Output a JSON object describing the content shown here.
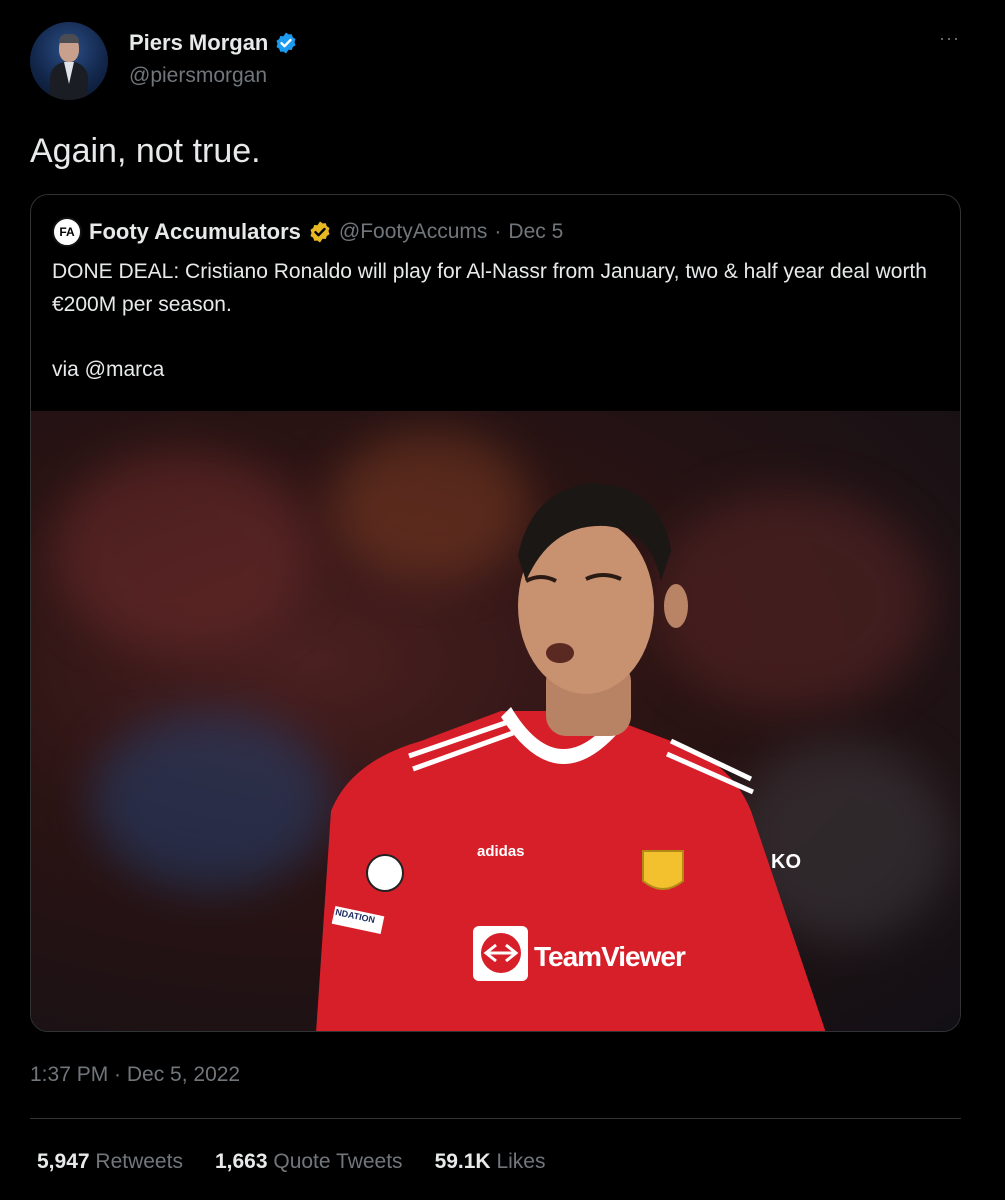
{
  "author": {
    "name": "Piers Morgan",
    "handle": "@piersmorgan",
    "verified_badge_color": "#1d9bf0"
  },
  "more_menu": "···",
  "tweet": {
    "text": "Again, not true.",
    "timestamp": "1:37 PM · Dec 5, 2022"
  },
  "quoted_tweet": {
    "logo_text": "FA",
    "name": "Footy Accumulators",
    "verified_badge_color": "#e8b823",
    "handle": "@FootyAccums",
    "separator": "·",
    "date": "Dec 5",
    "body_line1": "DONE DEAL: Cristiano Ronaldo will play for Al-Nassr from January, two & half year deal worth €200M per season.",
    "body_line2": "via @marca",
    "image": {
      "shirt_sponsor": "TeamViewer",
      "shirt_brand": "adidas",
      "sleeve_text": "KO",
      "badge_text": "NDATION"
    }
  },
  "stats": {
    "retweets_count": "5,947",
    "retweets_label": "Retweets",
    "quotes_count": "1,663",
    "quotes_label": "Quote Tweets",
    "likes_count": "59.1K",
    "likes_label": "Likes"
  }
}
